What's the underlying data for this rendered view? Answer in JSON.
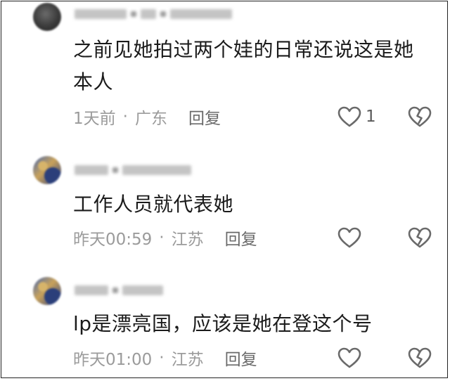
{
  "comments": [
    {
      "text": "之前见她拍过两个娃的日常还说这是她本人",
      "time": "1天前",
      "location": "广东",
      "reply_label": "回复",
      "like_count": "1",
      "like_icon": "heart-outline-icon",
      "dislike_icon": "broken-heart-icon"
    },
    {
      "text": "工作人员就代表她",
      "time": "昨天00:59",
      "location": "江苏",
      "reply_label": "回复",
      "like_icon": "heart-outline-icon",
      "dislike_icon": "broken-heart-icon"
    },
    {
      "text": "lp是漂亮国，应该是她在登这个号",
      "time": "昨天01:00",
      "location": "江苏",
      "reply_label": "回复",
      "like_icon": "heart-outline-icon",
      "dislike_icon": "broken-heart-icon"
    }
  ],
  "separator": "·",
  "colors": {
    "text": "#1b1b1b",
    "meta": "#9b9b9b",
    "icon": "#6a6a6a"
  }
}
